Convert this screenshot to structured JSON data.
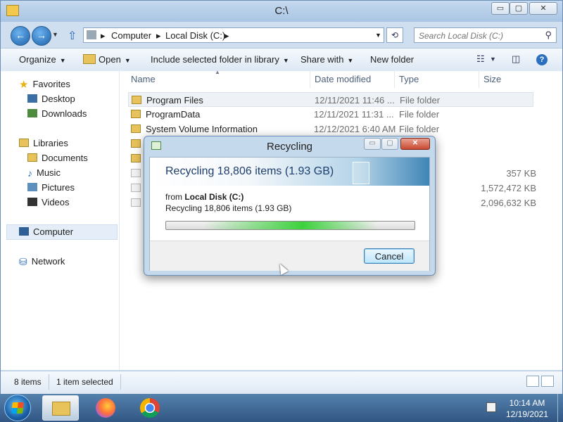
{
  "window": {
    "title": "C:\\",
    "caption": {
      "min": "▭",
      "max": "▢",
      "close": "✕"
    }
  },
  "nav": {
    "breadcrumbs": [
      "Computer",
      "Local Disk (C:)"
    ],
    "search_placeholder": "Search Local Disk (C:)"
  },
  "toolbar": {
    "organize": "Organize",
    "open": "Open",
    "include": "Include selected folder in library",
    "share": "Share with",
    "new_folder": "New folder"
  },
  "sidebar": {
    "favorites": "Favorites",
    "desktop": "Desktop",
    "downloads": "Downloads",
    "libraries": "Libraries",
    "documents": "Documents",
    "music": "Music",
    "pictures": "Pictures",
    "videos": "Videos",
    "computer": "Computer",
    "network": "Network"
  },
  "columns": {
    "name": "Name",
    "date": "Date modified",
    "type": "Type",
    "size": "Size"
  },
  "files": [
    {
      "name": "Program Files",
      "date": "12/11/2021 11:46 ...",
      "type": "File folder",
      "size": ""
    },
    {
      "name": "ProgramData",
      "date": "12/11/2021 11:31 ...",
      "type": "File folder",
      "size": ""
    },
    {
      "name": "System Volume Information",
      "date": "12/12/2021 6:40 AM",
      "type": "File folder",
      "size": ""
    },
    {
      "name": "",
      "date": "",
      "type": "",
      "size": ""
    },
    {
      "name": "",
      "date": "",
      "type": "",
      "size": ""
    },
    {
      "name": "",
      "date": "",
      "type": "",
      "size": "357 KB"
    },
    {
      "name": "",
      "date": "",
      "type": "",
      "size": "1,572,472 KB"
    },
    {
      "name": "",
      "date": "",
      "type": "",
      "size": "2,096,632 KB"
    }
  ],
  "status": {
    "items": "8 items",
    "selected": "1 item selected"
  },
  "dialog": {
    "title": "Recycling",
    "heading": "Recycling 18,806 items (1.93 GB)",
    "from_prefix": "from",
    "from_source": "Local Disk (C:)",
    "detail": "Recycling 18,806 items (1.93 GB)",
    "cancel": "Cancel",
    "close_glyph": "✕",
    "min_glyph": "▭",
    "max_glyph": "▢"
  },
  "taskbar": {
    "time": "10:14 AM",
    "date": "12/19/2021"
  },
  "colors": {
    "accent": "#1c5fa8",
    "progress": "#3cd23c"
  }
}
